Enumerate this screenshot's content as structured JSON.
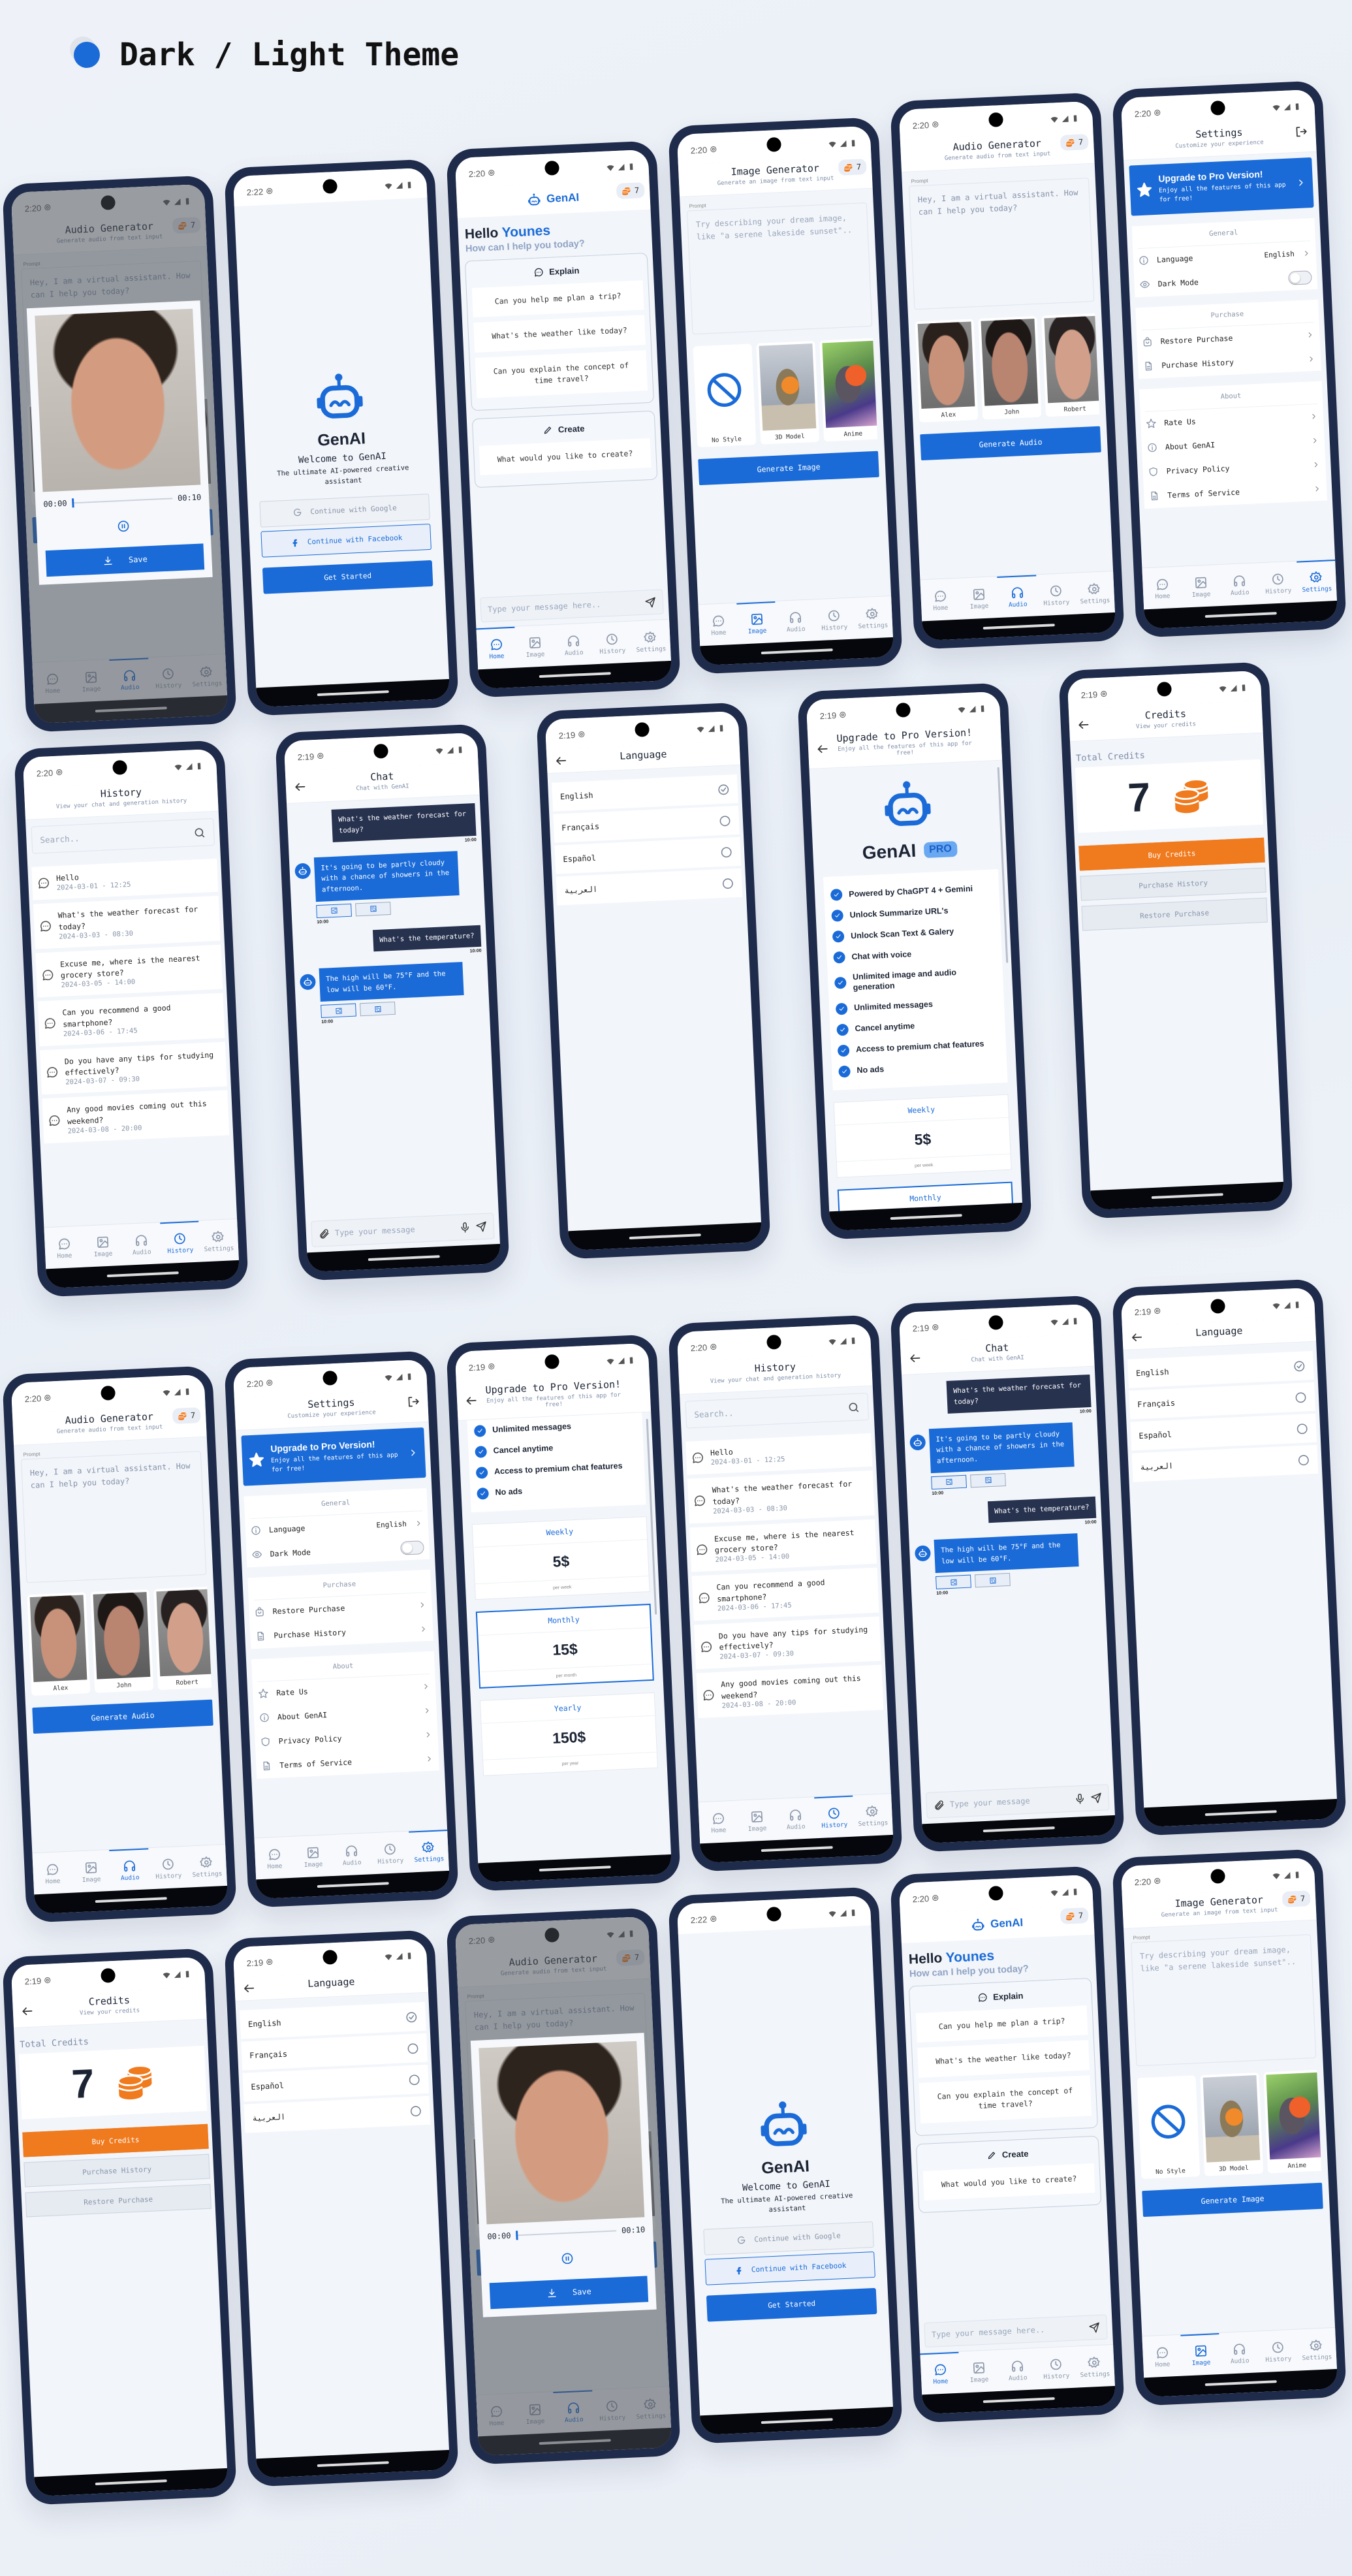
{
  "header": {
    "title": "Dark / Light Theme",
    "accent": "#1a6bd8"
  },
  "colors": {
    "primary": "#1a6bd8",
    "frame": "#1f2b4a",
    "user_bubble": "#27324f",
    "buy": "#f07a1e",
    "background": "#f2f5fa"
  },
  "credits_badge": "7",
  "nav": {
    "items": [
      {
        "label": "Home",
        "icon": "chat-bubble-icon"
      },
      {
        "label": "Image",
        "icon": "image-icon"
      },
      {
        "label": "Audio",
        "icon": "headphones-icon"
      },
      {
        "label": "History",
        "icon": "clock-icon"
      },
      {
        "label": "Settings",
        "icon": "settings-icon"
      }
    ]
  },
  "screens": {
    "welcome": {
      "time": "2:22",
      "app_name": "GenAI",
      "title": "Welcome to GenAI",
      "subtitle": "The ultimate AI-powered creative assistant",
      "google": "Continue with Google",
      "facebook": "Continue with Facebook",
      "start": "Get Started"
    },
    "home": {
      "time": "2:20",
      "app_name": "GenAI",
      "hello": "Hello",
      "user": "Younes",
      "question": "How can I help you today?",
      "active_tab": 0,
      "sections": [
        {
          "title": "Explain",
          "icon": "chat-bubble-icon",
          "prompts": [
            "Can you help me plan a trip?",
            "What's the weather like today?",
            "Can you explain the concept of time travel?"
          ]
        },
        {
          "title": "Create",
          "icon": "pencil-icon",
          "prompts": [
            "What would you like to create?"
          ]
        }
      ],
      "input_placeholder": "Type your message here.."
    },
    "image_gen": {
      "time": "2:20",
      "title": "Image Generator",
      "subtitle": "Generate an image from text input",
      "prompt_label": "Prompt",
      "placeholder": "Try describing your dream image, like \"a serene lakeside sunset\"..",
      "styles": [
        "No Style",
        "3D Model",
        "Anime"
      ],
      "button": "Generate Image",
      "active_tab": 1
    },
    "audio_gen": {
      "time": "2:20",
      "title": "Audio Generator",
      "subtitle": "Generate audio from text input",
      "prompt_label": "Prompt",
      "text": "Hey, I am a virtual assistant. How can I help you today?",
      "voices": [
        "Alex",
        "John",
        "Robert"
      ],
      "button": "Generate Audio",
      "active_tab": 2
    },
    "audio_player": {
      "current": "00:00",
      "duration": "00:10",
      "progress": 0,
      "save": "Save"
    },
    "history": {
      "time": "2:20",
      "title": "History",
      "subtitle": "View your chat and generation history",
      "search_placeholder": "Search..",
      "active_tab": 3,
      "items": [
        {
          "text": "Hello",
          "date": "2024-03-01 - 12:25"
        },
        {
          "text": "What's the weather forecast for today?",
          "date": "2024-03-03 - 08:30"
        },
        {
          "text": "Excuse me, where is the nearest grocery store?",
          "date": "2024-03-05 - 14:00"
        },
        {
          "text": "Can you recommend a good smartphone?",
          "date": "2024-03-06 - 17:45"
        },
        {
          "text": "Do you have any tips for studying effectively?",
          "date": "2024-03-07 - 09:30"
        },
        {
          "text": "Any good movies coming out this weekend?",
          "date": "2024-03-08 - 20:00"
        }
      ]
    },
    "chat": {
      "time": "2:19",
      "title": "Chat",
      "subtitle": "Chat with GenAI",
      "input_placeholder": "Type your message",
      "messages": [
        {
          "role": "user",
          "text": "What's the weather forecast for today?",
          "time": "10:00"
        },
        {
          "role": "bot",
          "text": "It's going to be partly cloudy with a chance of showers in the afternoon.",
          "time": "10:00"
        },
        {
          "role": "user",
          "text": "What's the temperature?",
          "time": "10:00"
        },
        {
          "role": "bot",
          "text": "The high will be 75°F and the low will be 60°F.",
          "time": "10:00"
        }
      ]
    },
    "language": {
      "time": "2:19",
      "title": "Language",
      "options": [
        "English",
        "Français",
        "Español",
        "العربية"
      ],
      "selected": "English"
    },
    "upgrade": {
      "time": "2:19",
      "title": "Upgrade to Pro Version!",
      "subtitle": "Enjoy all the features of this app for free!",
      "app_name": "GenAI",
      "badge": "PRO",
      "features": [
        "Powered by ChaGPT 4 + Gemini",
        "Unlock Summarize URL's",
        "Unlock Scan Text & Galery",
        "Chat with voice",
        "Unlimited image and audio generation",
        "Unlimited messages",
        "Cancel anytime",
        "Access to premium chat features",
        "No ads"
      ],
      "plans": [
        {
          "name": "Weekly",
          "price": "5$",
          "period": "per week"
        },
        {
          "name": "Monthly",
          "price": "15$",
          "period": "per month",
          "selected": true
        },
        {
          "name": "Yearly",
          "price": "150$",
          "period": "per year"
        }
      ]
    },
    "credits": {
      "time": "2:19",
      "title": "Credits",
      "subtitle": "View your credits",
      "total_label": "Total Credits",
      "total": "7",
      "buy": "Buy Credits",
      "history": "Purchase History",
      "restore": "Restore Purchase"
    },
    "settings": {
      "time": "2:20",
      "title": "Settings",
      "subtitle": "Customize your experience",
      "banner_title": "Upgrade to Pro Version!",
      "banner_subtitle": "Enjoy all the features of this app for free!",
      "active_tab": 4,
      "sections": [
        {
          "title": "General",
          "items": [
            {
              "label": "Language",
              "value": "English",
              "icon": "info-icon"
            },
            {
              "label": "Dark Mode",
              "toggle": false,
              "icon": "eye-icon"
            }
          ]
        },
        {
          "title": "Purchase",
          "items": [
            {
              "label": "Restore Purchase",
              "icon": "bag-icon"
            },
            {
              "label": "Purchase History",
              "icon": "document-icon"
            }
          ]
        },
        {
          "title": "About",
          "items": [
            {
              "label": "Rate Us",
              "icon": "star-outline-icon"
            },
            {
              "label": "About GenAI",
              "icon": "info-icon"
            },
            {
              "label": "Privacy Policy",
              "icon": "shield-icon"
            },
            {
              "label": "Terms of Service",
              "icon": "document-icon"
            }
          ]
        }
      ]
    }
  }
}
